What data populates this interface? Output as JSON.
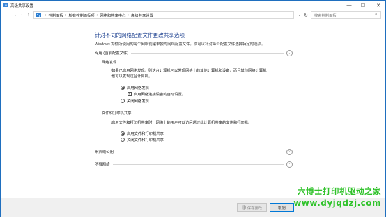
{
  "window": {
    "title": "高级共享设置",
    "controls": {
      "minimize": "—",
      "maximize": "☐",
      "close": "✕"
    }
  },
  "nav": {
    "back": "←",
    "forward": "→",
    "recent": "⌄",
    "up": "↑",
    "breadcrumbs": [
      "控制面板",
      "所有控制面板项",
      "网络和共享中心",
      "高级共享设置"
    ],
    "separator": "›",
    "address_dropdown": "⌄",
    "refresh": "↻",
    "search_placeholder": "搜索控制面板",
    "search_icon": "search-icon"
  },
  "main": {
    "heading": "针对不同的网络配置文件更改共享选项",
    "description": "Windows 为你所使用的每个网络创建单独的网络配置文件。你可以针对每个配置文件选择特定的选项。",
    "profiles": [
      {
        "label": "专用 (当前配置文件)",
        "expanded": true,
        "chevron": "︿",
        "groups": [
          {
            "title": "网络发现",
            "text": [
              "如果已启用网络发现，则这台计算机可以发现网络上的其他计算机和设备，而且其他网络计算机",
              "也可以发现这台计算机。"
            ],
            "options": [
              {
                "type": "radio",
                "label": "启用网络发现",
                "selected": true
              },
              {
                "type": "checkbox",
                "label": "启用网络连接设备的自动设置。",
                "checked": true
              },
              {
                "type": "radio",
                "label": "关闭网络发现",
                "selected": false
              }
            ]
          },
          {
            "title": "文件和打印机共享",
            "text": [
              "启用文件和打印机共享时，网络上的用户可以访问通过此计算机共享的文件和打印机。"
            ],
            "options": [
              {
                "type": "radio",
                "label": "启用文件和打印机共享",
                "selected": true
              },
              {
                "type": "radio",
                "label": "关闭文件和打印机共享",
                "selected": false
              }
            ]
          }
        ]
      },
      {
        "label": "来宾或公用",
        "expanded": false,
        "chevron": "﹀"
      },
      {
        "label": "所有网络",
        "expanded": false,
        "chevron": "﹀"
      }
    ]
  },
  "footer": {
    "save_label": "保存更改",
    "save_enabled": false,
    "cancel_label": "取消"
  },
  "watermark": {
    "line1": "六博士打印机驱动之家",
    "line2": "www.dyjqdzj.com"
  },
  "colors": {
    "heading": "#1b3f8f",
    "window_border": "#1f6fbf",
    "watermark": "#2fc22a",
    "cancel_focus": "#0078d7"
  }
}
